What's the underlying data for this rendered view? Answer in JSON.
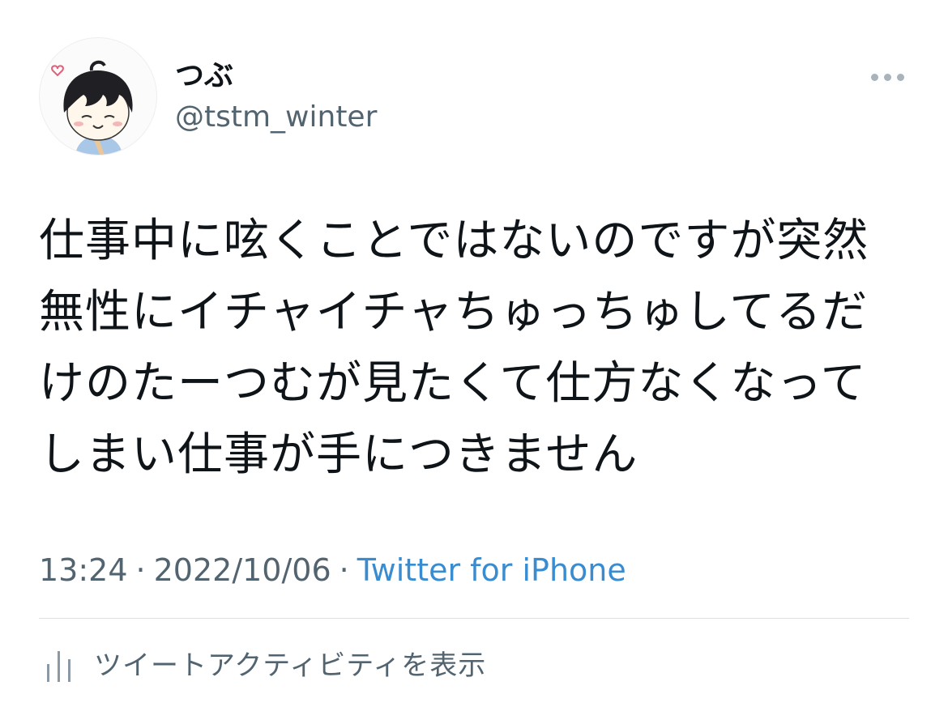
{
  "tweet": {
    "author": {
      "display_name": "つぶ",
      "handle": "@tstm_winter",
      "avatar_icon": "avatar-illustration"
    },
    "more_icon": "more-horizontal-icon",
    "text_lines": [
      "仕事中に呟くことではないのですが突然",
      "無性にイチャイチャちゅっちゅしてるだ",
      "けのたーつむが見たくて仕方なくなって",
      "しまい仕事が手につきません"
    ],
    "time": "13:24",
    "separator": "·",
    "date": "2022/10/06",
    "source": "Twitter for iPhone",
    "activity": {
      "icon": "activity-bars-icon",
      "label": "ツイートアクティビティを表示"
    }
  },
  "colors": {
    "text_primary": "#0f1419",
    "text_secondary": "#536471",
    "link": "#3a8cd0",
    "divider": "#dcdfe2"
  }
}
